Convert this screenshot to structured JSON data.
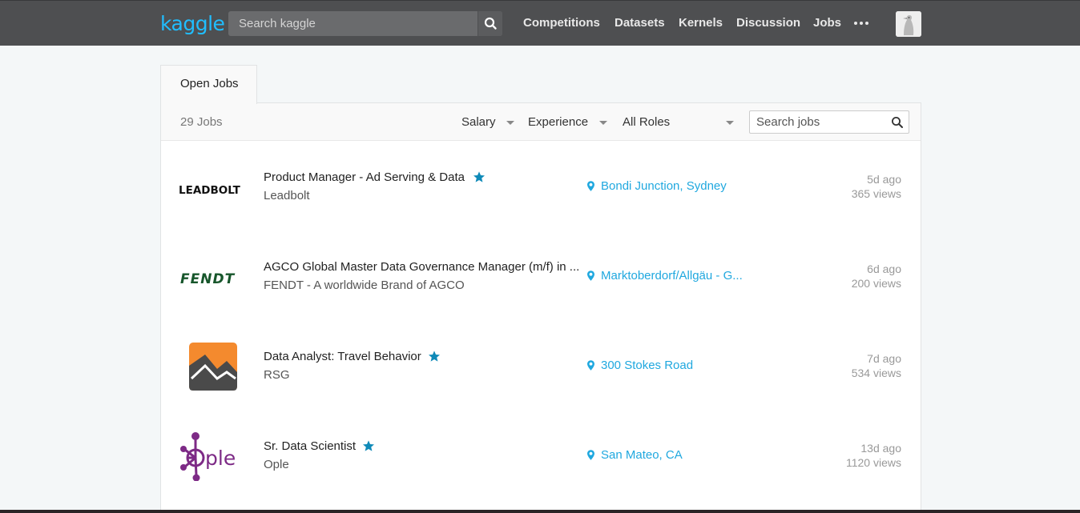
{
  "header": {
    "logo": "kaggle",
    "search_placeholder": "Search kaggle",
    "nav": [
      "Competitions",
      "Datasets",
      "Kernels",
      "Discussion",
      "Jobs"
    ]
  },
  "tab": {
    "label": "Open Jobs"
  },
  "filters": {
    "count": "29 Jobs",
    "salary": "Salary",
    "experience": "Experience",
    "roles": "All Roles",
    "search_placeholder": "Search jobs"
  },
  "jobs": [
    {
      "title": "Product Manager - Ad Serving & Data",
      "company": "Leadbolt",
      "location": "Bondi Junction, Sydney",
      "age": "5d ago",
      "views": "365 views",
      "featured": true,
      "logo_text": "LEADBOLT"
    },
    {
      "title": "AGCO Global Master Data Governance Manager (m/f) in ...",
      "company": "FENDT - A worldwide Brand of AGCO",
      "location": "Marktoberdorf/Allgäu - G...",
      "age": "6d ago",
      "views": "200 views",
      "featured": false,
      "logo_text": "FENDT"
    },
    {
      "title": "Data Analyst: Travel Behavior",
      "company": "RSG",
      "location": "300 Stokes Road",
      "age": "7d ago",
      "views": "534 views",
      "featured": true
    },
    {
      "title": "Sr. Data Scientist",
      "company": "Ople",
      "location": "San Mateo, CA",
      "age": "13d ago",
      "views": "1120 views",
      "featured": true,
      "logo_text": "ple"
    }
  ],
  "colors": {
    "accent": "#20beff",
    "link": "#20a8df",
    "topbar": "#4e4f51",
    "star": "#0f8ab8"
  }
}
